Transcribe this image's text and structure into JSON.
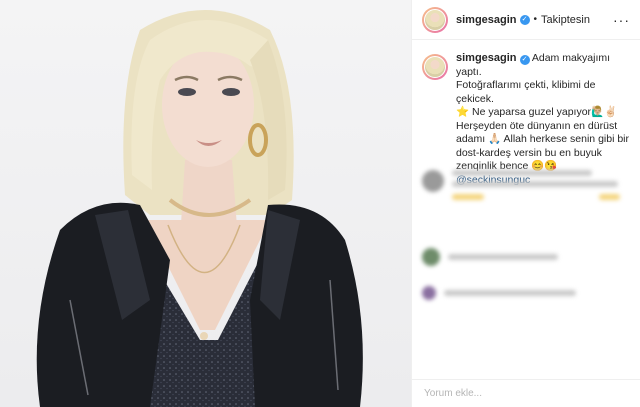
{
  "header": {
    "username": "simgesagin",
    "verified_icon": "verified-badge-icon",
    "separator": "•",
    "follow_status": "Takiptesin",
    "more_icon": "more-options-icon"
  },
  "caption": {
    "username": "simgesagin",
    "line1": "Adam makyajımı yaptı.",
    "line2": "Fotoğraflarımı çekti, klibimi de çekicek.",
    "line3": "⭐ Ne yaparsa guzel yapıyor🙋🏼‍♂️✌🏻",
    "line4": "Herşeyden öte dünyanın en dürüst",
    "line5": "adamı 🙏🏻 Allah herkese senin gibi bir",
    "line6": "dost-kardeş versin bu en buyuk",
    "line7": "zenqinlik bence 😊😘",
    "mention": "@seckinsunguc"
  },
  "add_comment": {
    "placeholder": "Yorum ekle..."
  },
  "colors": {
    "verified": "#3897f0",
    "mention": "#00376b",
    "jacket": "#1b1d22",
    "hair": "#ece3c3"
  }
}
